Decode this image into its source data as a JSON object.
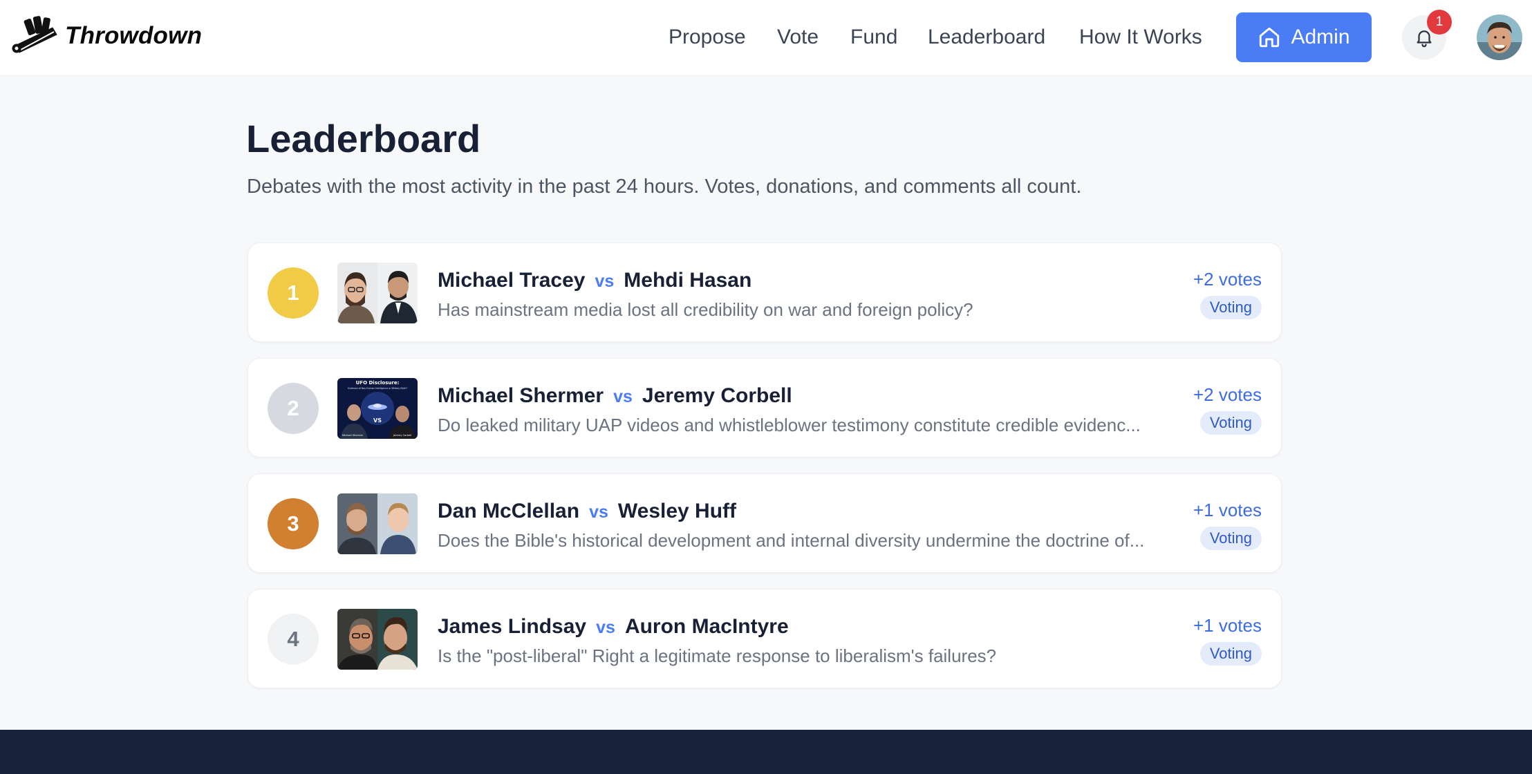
{
  "brand": {
    "name": "Throwdown"
  },
  "nav": {
    "links": [
      "Propose",
      "Vote",
      "Fund",
      "Leaderboard",
      "How It Works"
    ],
    "admin_label": "Admin",
    "notification_count": "1"
  },
  "colors": {
    "accent": "#4a7cf6",
    "footer": "#18213a",
    "gold": "#f1cb46",
    "silver": "#d6d9df",
    "bronze": "#d0802f",
    "neutral": "#f1f2f4"
  },
  "page": {
    "title": "Leaderboard",
    "subtitle": "Debates with the most activity in the past 24 hours. Votes, donations, and comments all count."
  },
  "leaderboard": [
    {
      "rank": "1",
      "debater_a": "Michael Tracey",
      "vs": "vs",
      "debater_b": "Mehdi Hasan",
      "question": "Has mainstream media lost all credibility on war and foreign policy?",
      "votes": "+2 votes",
      "status": "Voting"
    },
    {
      "rank": "2",
      "debater_a": "Michael Shermer",
      "vs": "vs",
      "debater_b": "Jeremy Corbell",
      "question": "Do leaked military UAP videos and whistleblower testimony constitute credible evidenc...",
      "votes": "+2 votes",
      "status": "Voting",
      "thumb_text": {
        "title": "UFO Disclosure:",
        "sub": "Evidence of Non-Human Intelligence or Military Myth?",
        "vs": "VS",
        "left_name": "Michael Shermer",
        "right_name": "Jeremy Corbell"
      }
    },
    {
      "rank": "3",
      "debater_a": "Dan McClellan",
      "vs": "vs",
      "debater_b": "Wesley Huff",
      "question": "Does the Bible's historical development and internal diversity undermine the doctrine of...",
      "votes": "+1 votes",
      "status": "Voting"
    },
    {
      "rank": "4",
      "debater_a": "James Lindsay",
      "vs": "vs",
      "debater_b": "Auron MacIntyre",
      "question": "Is the \"post-liberal\" Right a legitimate response to liberalism's failures?",
      "votes": "+1 votes",
      "status": "Voting"
    }
  ]
}
